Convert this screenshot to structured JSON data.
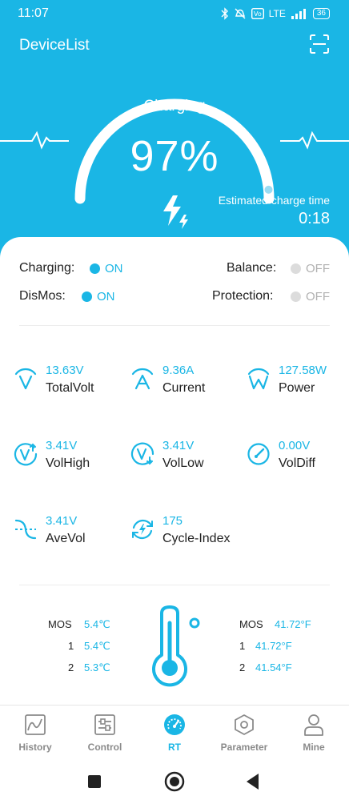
{
  "status": {
    "time": "11:07",
    "network": "LTE",
    "battery": "36"
  },
  "header": {
    "title": "DeviceList",
    "scan_icon": "scan-icon"
  },
  "gauge": {
    "state_label": "Charging",
    "percent_text": "97%",
    "level": 0.97,
    "est_label": "Estimated charge time",
    "est_value": "0:18",
    "accent": "#1ab6e5"
  },
  "states": [
    {
      "label": "Charging:",
      "value": "ON",
      "status": "on"
    },
    {
      "label": "Balance:",
      "value": "OFF",
      "status": "off"
    },
    {
      "label": "DisMos:",
      "value": "ON",
      "status": "on"
    },
    {
      "label": "Protection:",
      "value": "OFF",
      "status": "off"
    }
  ],
  "metrics": [
    {
      "value": "13.63V",
      "label": "TotalVolt",
      "icon": "voltage-icon"
    },
    {
      "value": "9.36A",
      "label": "Current",
      "icon": "current-icon"
    },
    {
      "value": "127.58W",
      "label": "Power",
      "icon": "power-icon"
    },
    {
      "value": "3.41V",
      "label": "VolHigh",
      "icon": "vol-high-icon"
    },
    {
      "value": "3.41V",
      "label": "VolLow",
      "icon": "vol-low-icon"
    },
    {
      "value": "0.00V",
      "label": "VolDiff",
      "icon": "gauge-icon"
    },
    {
      "value": "3.41V",
      "label": "AveVol",
      "icon": "average-icon"
    },
    {
      "value": "175",
      "label": "Cycle-Index",
      "icon": "cycle-icon"
    }
  ],
  "temps": {
    "celsius": [
      {
        "key": "MOS",
        "value": "5.4℃"
      },
      {
        "key": "1",
        "value": "5.4℃"
      },
      {
        "key": "2",
        "value": "5.3℃"
      }
    ],
    "fahrenheit": [
      {
        "key": "MOS",
        "value": "41.72°F"
      },
      {
        "key": "1",
        "value": "41.72°F"
      },
      {
        "key": "2",
        "value": "41.54°F"
      }
    ]
  },
  "tabs": [
    {
      "label": "History",
      "icon": "history-chart-icon",
      "active": false
    },
    {
      "label": "Control",
      "icon": "control-sliders-icon",
      "active": false
    },
    {
      "label": "RT",
      "icon": "rt-dial-icon",
      "active": true
    },
    {
      "label": "Parameter",
      "icon": "parameter-hexagon-icon",
      "active": false
    },
    {
      "label": "Mine",
      "icon": "user-icon",
      "active": false
    }
  ]
}
